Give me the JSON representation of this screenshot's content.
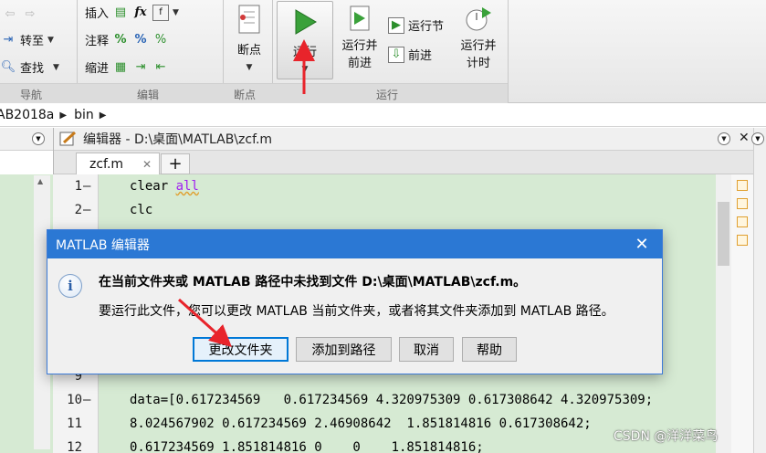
{
  "ribbon": {
    "nav_group": {
      "label": "导航",
      "goto": "转至",
      "find": "查找"
    },
    "edit_group": {
      "label": "编辑",
      "insert": "插入",
      "comment": "注释",
      "indent": "缩进",
      "fx": "fx"
    },
    "breakpoint_group": {
      "label": "断点",
      "breakpoint": "断点"
    },
    "run_group": {
      "label": "运行",
      "run": "运行",
      "run_advance": [
        "运行并",
        "前进"
      ],
      "run_section": "运行节",
      "advance": "前进",
      "run_time": [
        "运行并",
        "计时"
      ]
    }
  },
  "breadcrumb": [
    "AB2018a",
    "bin"
  ],
  "editor": {
    "title": "编辑器 - D:\\桌面\\MATLAB\\zcf.m",
    "tab_name": "zcf.m",
    "tab_close": "✕",
    "tab_add": "+",
    "lines": [
      {
        "num": "1",
        "marker": "—",
        "pre": "clear ",
        "kw": "all"
      },
      {
        "num": "2",
        "marker": "—",
        "pre": "clc",
        "kw": ""
      },
      {
        "num": "9",
        "marker": "",
        "pre": "",
        "kw": ""
      },
      {
        "num": "10",
        "marker": "—",
        "pre": "data=[0.617234569   0.617234569 4.320975309 0.617308642 4.320975309;",
        "kw": ""
      },
      {
        "num": "11",
        "marker": "",
        "pre": "8.024567902 0.617234569 2.46908642  1.851814816 0.617308642;",
        "kw": ""
      },
      {
        "num": "12",
        "marker": "",
        "pre": "0.617234569 1.851814816 0    0    1.851814816;",
        "kw": ""
      }
    ]
  },
  "dialog": {
    "title": "MATLAB 编辑器",
    "close": "✕",
    "icon": "i",
    "heading": "在当前文件夹或 MATLAB 路径中未找到文件 D:\\桌面\\MATLAB\\zcf.m。",
    "body": "要运行此文件，您可以更改 MATLAB 当前文件夹，或者将其文件夹添加到 MATLAB 路径。",
    "buttons": {
      "change_folder": "更改文件夹",
      "add_to_path": "添加到路径",
      "cancel": "取消",
      "help": "帮助"
    }
  },
  "watermark": "CSDN @洋洋菜鸟",
  "colors": {
    "dialog_title_bg": "#2b78d4",
    "code_bg": "#d6ead3",
    "annotation_arrow": "#e8242b",
    "primary_button_border": "#0078d7"
  }
}
